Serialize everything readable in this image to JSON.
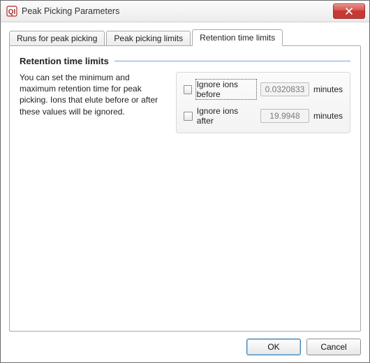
{
  "window": {
    "title": "Peak Picking Parameters"
  },
  "tabs": {
    "items": [
      {
        "label": "Runs for peak picking",
        "active": false
      },
      {
        "label": "Peak picking limits",
        "active": false
      },
      {
        "label": "Retention time limits",
        "active": true
      }
    ]
  },
  "section": {
    "title": "Retention time limits",
    "description": "You can set the minimum and maximum retention time for peak picking. Ions that elute before or after these values will be ignored."
  },
  "params": {
    "before": {
      "label": "Ignore ions before",
      "value": "0.0320833",
      "unit": "minutes",
      "checked": false
    },
    "after": {
      "label": "Ignore ions after",
      "value": "19.9948",
      "unit": "minutes",
      "checked": false
    }
  },
  "buttons": {
    "ok": "OK",
    "cancel": "Cancel"
  }
}
